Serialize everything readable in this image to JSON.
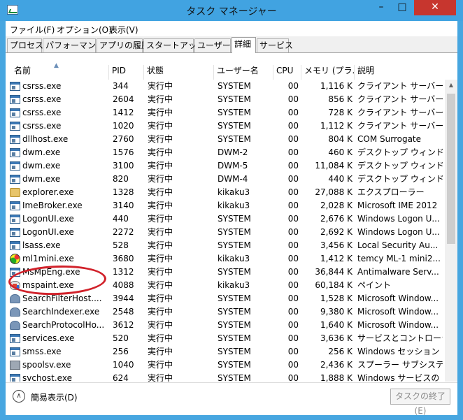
{
  "window": {
    "title": "タスク マネージャー",
    "controls": {
      "minimize": "–",
      "maximize": "□",
      "close": "✕"
    }
  },
  "menu": [
    "ファイル(F)",
    "オプション(O)",
    "表示(V)"
  ],
  "tabs": [
    "プロセス",
    "パフォーマンス",
    "アプリの履歴",
    "スタートアップ",
    "ユーザー",
    "詳細",
    "サービス"
  ],
  "active_tab": "詳細",
  "columns": [
    "名前",
    "PID",
    "状態",
    "ユーザー名",
    "CPU",
    "メモリ (プラ...",
    "説明"
  ],
  "sort_column": "名前",
  "rows": [
    {
      "icon": "window-icon",
      "name": "csrss.exe",
      "pid": "344",
      "status": "実行中",
      "user": "SYSTEM",
      "cpu": "00",
      "mem": "1,116 K",
      "desc": "クライアント サーバー ..."
    },
    {
      "icon": "window-icon",
      "name": "csrss.exe",
      "pid": "2604",
      "status": "実行中",
      "user": "SYSTEM",
      "cpu": "00",
      "mem": "856 K",
      "desc": "クライアント サーバー ..."
    },
    {
      "icon": "window-icon",
      "name": "csrss.exe",
      "pid": "1412",
      "status": "実行中",
      "user": "SYSTEM",
      "cpu": "00",
      "mem": "728 K",
      "desc": "クライアント サーバー ..."
    },
    {
      "icon": "window-icon",
      "name": "csrss.exe",
      "pid": "1020",
      "status": "実行中",
      "user": "SYSTEM",
      "cpu": "00",
      "mem": "1,112 K",
      "desc": "クライアント サーバー ..."
    },
    {
      "icon": "window-icon",
      "name": "dllhost.exe",
      "pid": "2760",
      "status": "実行中",
      "user": "SYSTEM",
      "cpu": "00",
      "mem": "804 K",
      "desc": "COM Surrogate"
    },
    {
      "icon": "window-icon",
      "name": "dwm.exe",
      "pid": "1576",
      "status": "実行中",
      "user": "DWM-2",
      "cpu": "00",
      "mem": "460 K",
      "desc": "デスクトップ ウィンドウ ..."
    },
    {
      "icon": "window-icon",
      "name": "dwm.exe",
      "pid": "3100",
      "status": "実行中",
      "user": "DWM-5",
      "cpu": "00",
      "mem": "11,084 K",
      "desc": "デスクトップ ウィンドウ ..."
    },
    {
      "icon": "window-icon",
      "name": "dwm.exe",
      "pid": "820",
      "status": "実行中",
      "user": "DWM-4",
      "cpu": "00",
      "mem": "440 K",
      "desc": "デスクトップ ウィンドウ ..."
    },
    {
      "icon": "folder-icon",
      "name": "explorer.exe",
      "pid": "1328",
      "status": "実行中",
      "user": "kikaku3",
      "cpu": "00",
      "mem": "27,088 K",
      "desc": "エクスプローラー"
    },
    {
      "icon": "window-icon",
      "name": "ImeBroker.exe",
      "pid": "3140",
      "status": "実行中",
      "user": "kikaku3",
      "cpu": "00",
      "mem": "2,028 K",
      "desc": "Microsoft IME 2012"
    },
    {
      "icon": "window-icon",
      "name": "LogonUI.exe",
      "pid": "440",
      "status": "実行中",
      "user": "SYSTEM",
      "cpu": "00",
      "mem": "2,676 K",
      "desc": "Windows Logon U..."
    },
    {
      "icon": "window-icon",
      "name": "LogonUI.exe",
      "pid": "2272",
      "status": "実行中",
      "user": "SYSTEM",
      "cpu": "00",
      "mem": "2,692 K",
      "desc": "Windows Logon U..."
    },
    {
      "icon": "window-icon",
      "name": "lsass.exe",
      "pid": "528",
      "status": "実行中",
      "user": "SYSTEM",
      "cpu": "00",
      "mem": "3,456 K",
      "desc": "Local Security Au..."
    },
    {
      "icon": "ml1mini-icon",
      "name": "ml1mini.exe",
      "pid": "3680",
      "status": "実行中",
      "user": "kikaku3",
      "cpu": "00",
      "mem": "1,412 K",
      "desc": "temcy ML-1 mini2..."
    },
    {
      "icon": "window-icon",
      "name": "MsMpEng.exe",
      "pid": "1312",
      "status": "実行中",
      "user": "SYSTEM",
      "cpu": "00",
      "mem": "36,844 K",
      "desc": "Antimalware Serv..."
    },
    {
      "icon": "paint-icon",
      "name": "mspaint.exe",
      "pid": "4088",
      "status": "実行中",
      "user": "kikaku3",
      "cpu": "00",
      "mem": "60,184 K",
      "desc": "ペイント"
    },
    {
      "icon": "user-search-icon",
      "name": "SearchFilterHost....",
      "pid": "3944",
      "status": "実行中",
      "user": "SYSTEM",
      "cpu": "00",
      "mem": "1,528 K",
      "desc": "Microsoft Window..."
    },
    {
      "icon": "user-search-icon",
      "name": "SearchIndexer.exe",
      "pid": "2548",
      "status": "実行中",
      "user": "SYSTEM",
      "cpu": "00",
      "mem": "9,380 K",
      "desc": "Microsoft Window..."
    },
    {
      "icon": "user-search-icon",
      "name": "SearchProtocolHo...",
      "pid": "3612",
      "status": "実行中",
      "user": "SYSTEM",
      "cpu": "00",
      "mem": "1,640 K",
      "desc": "Microsoft Window..."
    },
    {
      "icon": "window-icon",
      "name": "services.exe",
      "pid": "520",
      "status": "実行中",
      "user": "SYSTEM",
      "cpu": "00",
      "mem": "3,636 K",
      "desc": "サービスとコントローラ..."
    },
    {
      "icon": "window-icon",
      "name": "smss.exe",
      "pid": "256",
      "status": "実行中",
      "user": "SYSTEM",
      "cpu": "00",
      "mem": "256 K",
      "desc": "Windows セッション ..."
    },
    {
      "icon": "printer-icon",
      "name": "spoolsv.exe",
      "pid": "1040",
      "status": "実行中",
      "user": "SYSTEM",
      "cpu": "00",
      "mem": "2,436 K",
      "desc": "スプーラー サブシステ..."
    },
    {
      "icon": "window-icon",
      "name": "svchost.exe",
      "pid": "624",
      "status": "実行中",
      "user": "SYSTEM",
      "cpu": "00",
      "mem": "1,888 K",
      "desc": "Windows サービスの ..."
    }
  ],
  "highlighted_process": "ml1mini.exe",
  "footer": {
    "fewer_details": "簡易表示(D)",
    "end_task": "タスクの終了(E)"
  }
}
